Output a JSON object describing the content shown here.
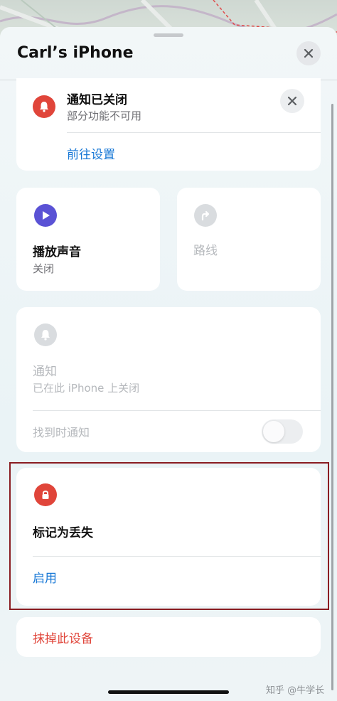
{
  "header": {
    "title": "Carl’s iPhone"
  },
  "notification_banner": {
    "title": "通知已关闭",
    "subtitle": "部分功能不可用",
    "action": "前往设置"
  },
  "play_sound": {
    "title": "播放声音",
    "status": "关闭"
  },
  "directions": {
    "title": "路线"
  },
  "notifications": {
    "title": "通知",
    "subtitle": "已在此 iPhone 上关闭",
    "notify_when_found": "找到时通知",
    "notify_when_found_on": false
  },
  "mark_as_lost": {
    "title": "标记为丢失",
    "action": "启用"
  },
  "erase": {
    "label": "抹掉此设备"
  },
  "watermark": "知乎 @牛学长",
  "colors": {
    "link": "#1677d6",
    "danger": "#e0453a",
    "play_purple": "#5a52d5",
    "highlight_border": "#8a1d22"
  },
  "icons": {
    "bell": "bell-icon",
    "play": "play-icon",
    "directions": "turn-arrow-icon",
    "lock": "lock-icon",
    "close": "close-icon"
  }
}
